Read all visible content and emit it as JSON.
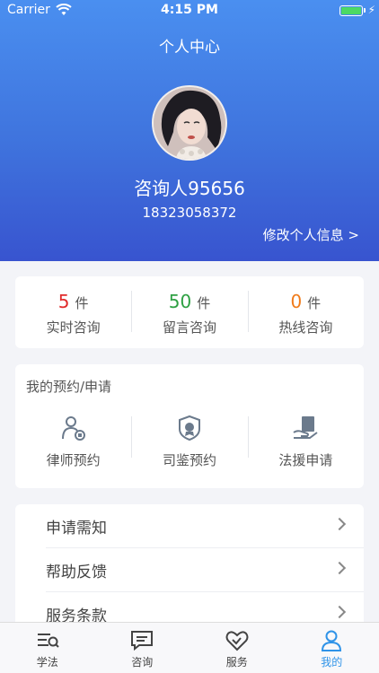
{
  "status": {
    "carrier": "Carrier",
    "time": "4:15 PM"
  },
  "header": {
    "title": "个人中心"
  },
  "profile": {
    "name": "咨询人95656",
    "phone": "18323058372",
    "edit_label": "修改个人信息 >"
  },
  "stats": [
    {
      "count": "5",
      "unit": "件",
      "label": "实时咨询",
      "color": "#e02b2b"
    },
    {
      "count": "50",
      "unit": "件",
      "label": "留言咨询",
      "color": "#2ea043"
    },
    {
      "count": "0",
      "unit": "件",
      "label": "热线咨询",
      "color": "#f07b1a"
    }
  ],
  "appointments": {
    "title": "我的预约/申请",
    "items": [
      {
        "label": "律师预约",
        "icon": "lawyer-icon"
      },
      {
        "label": "司鉴预约",
        "icon": "badge-icon"
      },
      {
        "label": "法援申请",
        "icon": "legal-aid-icon"
      }
    ]
  },
  "menu": [
    {
      "label": "申请需知"
    },
    {
      "label": "帮助反馈"
    },
    {
      "label": "服务条款"
    }
  ],
  "tabs": [
    {
      "label": "学法",
      "icon": "study-icon"
    },
    {
      "label": "咨询",
      "icon": "chat-icon"
    },
    {
      "label": "服务",
      "icon": "handshake-icon"
    },
    {
      "label": "我的",
      "icon": "user-icon",
      "active": true
    }
  ],
  "colors": {
    "accent": "#2f93e8",
    "header_top": "#4a8ff0",
    "header_bottom": "#3854cf",
    "icon": "#6b7a8c"
  }
}
